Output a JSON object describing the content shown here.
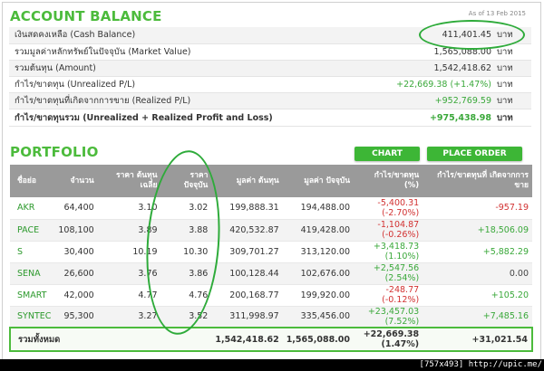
{
  "account": {
    "title": "ACCOUNT BALANCE",
    "as_of": "As of 13 Feb 2015",
    "rows": [
      {
        "label": "เงินสดคงเหลือ (Cash Balance)",
        "value": "411,401.45",
        "unit": "บาท",
        "green": false,
        "bold": false
      },
      {
        "label": "รวมมูลค่าหลักทรัพย์ในปัจจุบัน (Market Value)",
        "value": "1,565,088.00",
        "unit": "บาท",
        "green": false,
        "bold": false
      },
      {
        "label": "รวมต้นทุน (Amount)",
        "value": "1,542,418.62",
        "unit": "บาท",
        "green": false,
        "bold": false
      },
      {
        "label": "กำไร/ขาดทุน (Unrealized P/L)",
        "value": "+22,669.38 (+1.47%)",
        "unit": "บาท",
        "green": true,
        "bold": false
      },
      {
        "label": "กำไร/ขาดทุนที่เกิดจากการขาย (Realized P/L)",
        "value": "+952,769.59",
        "unit": "บาท",
        "green": true,
        "bold": false
      },
      {
        "label": "กำไร/ขาดทุนรวม (Unrealized + Realized Profit and Loss)",
        "value": "+975,438.98",
        "unit": "บาท",
        "green": true,
        "bold": true
      }
    ]
  },
  "portfolio": {
    "title": "PORTFOLIO",
    "chart_button": "CHART",
    "order_button": "PLACE ORDER",
    "headers": [
      "ชื่อย่อ",
      "จำนวน",
      "ราคา ต้นทุนเฉลี่ย",
      "ราคา ปัจจุบัน",
      "มูลค่า ต้นทุน",
      "มูลค่า ปัจจุบัน",
      "กำไร/ขาดทุน (%)",
      "กำไร/ขาดทุนที่ เกิดจากการขาย"
    ],
    "rows": [
      {
        "symbol": "AKR",
        "qty": "64,400",
        "avg_cost": "3.10",
        "price": "3.02",
        "cost_value": "199,888.31",
        "market_value": "194,488.00",
        "pl": "-5,400.31",
        "pl_pct": "(-2.70%)",
        "pl_dir": "neg",
        "realized": "-957.19",
        "realized_dir": "neg"
      },
      {
        "symbol": "PACE",
        "qty": "108,100",
        "avg_cost": "3.89",
        "price": "3.88",
        "cost_value": "420,532.87",
        "market_value": "419,428.00",
        "pl": "-1,104.87",
        "pl_pct": "(-0.26%)",
        "pl_dir": "neg",
        "realized": "+18,506.09",
        "realized_dir": "pos"
      },
      {
        "symbol": "S",
        "qty": "30,400",
        "avg_cost": "10.19",
        "price": "10.30",
        "cost_value": "309,701.27",
        "market_value": "313,120.00",
        "pl": "+3,418.73",
        "pl_pct": "(1.10%)",
        "pl_dir": "pos",
        "realized": "+5,882.29",
        "realized_dir": "pos"
      },
      {
        "symbol": "SENA",
        "qty": "26,600",
        "avg_cost": "3.76",
        "price": "3.86",
        "cost_value": "100,128.44",
        "market_value": "102,676.00",
        "pl": "+2,547.56",
        "pl_pct": "(2.54%)",
        "pl_dir": "pos",
        "realized": "0.00",
        "realized_dir": "neu"
      },
      {
        "symbol": "SMART",
        "qty": "42,000",
        "avg_cost": "4.77",
        "price": "4.76",
        "cost_value": "200,168.77",
        "market_value": "199,920.00",
        "pl": "-248.77",
        "pl_pct": "(-0.12%)",
        "pl_dir": "neg",
        "realized": "+105.20",
        "realized_dir": "pos"
      },
      {
        "symbol": "SYNTEC",
        "qty": "95,300",
        "avg_cost": "3.27",
        "price": "3.52",
        "cost_value": "311,998.97",
        "market_value": "335,456.00",
        "pl": "+23,457.03",
        "pl_pct": "(7.52%)",
        "pl_dir": "pos",
        "realized": "+7,485.16",
        "realized_dir": "pos"
      }
    ],
    "total": {
      "label": "รวมทั้งหมด",
      "cost_value": "1,542,418.62",
      "market_value": "1,565,088.00",
      "pl": "+22,669.38",
      "pl_pct": "(1.47%)",
      "realized": "+31,021.54"
    }
  },
  "watermark": "[757x493] http://upic.me/",
  "colors": {
    "accent_green": "#4cbb3c",
    "negative_red": "#d23232",
    "header_gray": "#9a9a9a"
  }
}
